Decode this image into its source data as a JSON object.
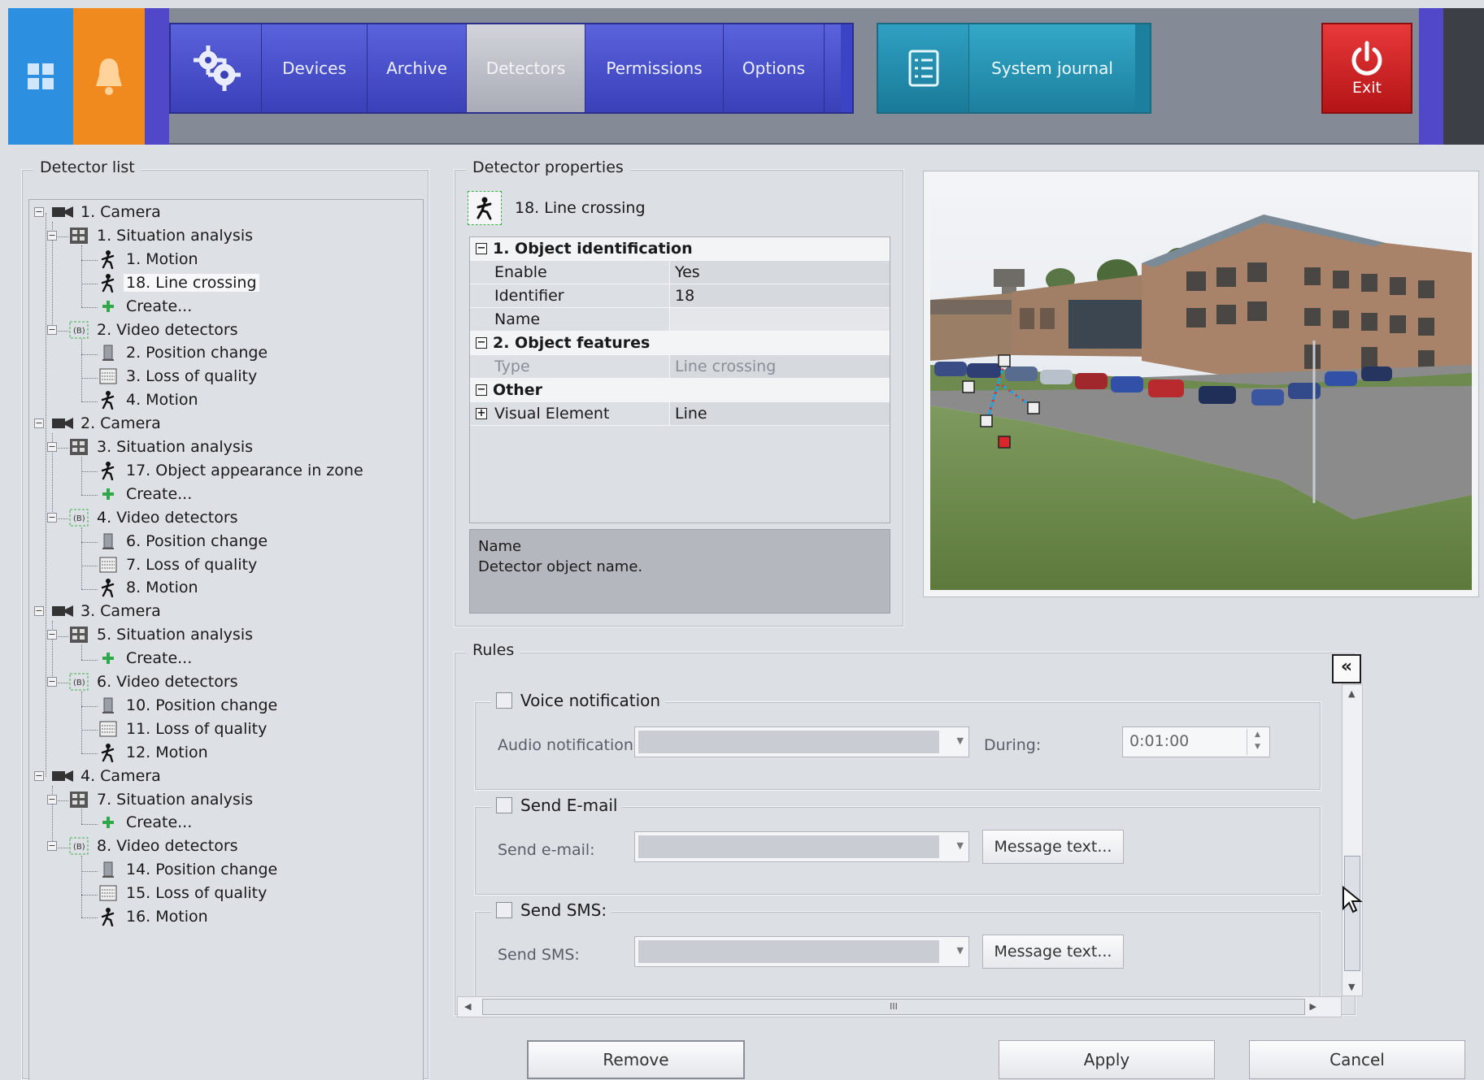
{
  "topbar": {
    "tiles": {
      "windows_icon": "windows-icon",
      "bell_icon": "bell-icon"
    },
    "nav": {
      "settings_icon": "gears-icon",
      "devices": "Devices",
      "archive": "Archive",
      "detectors": "Detectors",
      "permissions": "Permissions",
      "options": "Options",
      "active": "Detectors"
    },
    "journal": {
      "icon": "checklist-icon",
      "label": "System journal"
    },
    "exit": {
      "icon": "power-icon",
      "label": "Exit"
    }
  },
  "detector_list": {
    "title": "Detector list",
    "tree": [
      {
        "level": 0,
        "type": "camera",
        "label": "1. Camera",
        "expanded": true
      },
      {
        "level": 1,
        "type": "situation",
        "label": "1. Situation analysis",
        "expanded": true
      },
      {
        "level": 2,
        "type": "motion",
        "label": "1. Motion"
      },
      {
        "level": 2,
        "type": "motion",
        "label": "18. Line crossing",
        "selected": true
      },
      {
        "level": 2,
        "type": "create",
        "label": "Create..."
      },
      {
        "level": 1,
        "type": "video",
        "label": "2. Video detectors",
        "expanded": true
      },
      {
        "level": 2,
        "type": "position",
        "label": "2. Position change"
      },
      {
        "level": 2,
        "type": "quality",
        "label": "3. Loss of quality"
      },
      {
        "level": 2,
        "type": "motion",
        "label": "4. Motion"
      },
      {
        "level": 0,
        "type": "camera",
        "label": "2. Camera",
        "expanded": true
      },
      {
        "level": 1,
        "type": "situation",
        "label": "3. Situation analysis",
        "expanded": true
      },
      {
        "level": 2,
        "type": "motion",
        "label": "17. Object appearance in zone"
      },
      {
        "level": 2,
        "type": "create",
        "label": "Create..."
      },
      {
        "level": 1,
        "type": "video",
        "label": "4. Video detectors",
        "expanded": true
      },
      {
        "level": 2,
        "type": "position",
        "label": "6. Position change"
      },
      {
        "level": 2,
        "type": "quality",
        "label": "7. Loss of quality"
      },
      {
        "level": 2,
        "type": "motion",
        "label": "8. Motion"
      },
      {
        "level": 0,
        "type": "camera",
        "label": "3. Camera",
        "expanded": true
      },
      {
        "level": 1,
        "type": "situation",
        "label": "5. Situation analysis",
        "expanded": true
      },
      {
        "level": 2,
        "type": "create",
        "label": "Create..."
      },
      {
        "level": 1,
        "type": "video",
        "label": "6. Video detectors",
        "expanded": true
      },
      {
        "level": 2,
        "type": "position",
        "label": "10. Position change"
      },
      {
        "level": 2,
        "type": "quality",
        "label": "11. Loss of quality"
      },
      {
        "level": 2,
        "type": "motion",
        "label": "12. Motion"
      },
      {
        "level": 0,
        "type": "camera",
        "label": "4. Camera",
        "expanded": true
      },
      {
        "level": 1,
        "type": "situation",
        "label": "7. Situation analysis",
        "expanded": true
      },
      {
        "level": 2,
        "type": "create",
        "label": "Create..."
      },
      {
        "level": 1,
        "type": "video",
        "label": "8. Video detectors",
        "expanded": true
      },
      {
        "level": 2,
        "type": "position",
        "label": "14. Position change"
      },
      {
        "level": 2,
        "type": "quality",
        "label": "15. Loss of quality"
      },
      {
        "level": 2,
        "type": "motion",
        "label": "16. Motion"
      }
    ]
  },
  "detector_properties": {
    "title": "Detector properties",
    "header": {
      "icon": "line-crossing-icon",
      "label": "18. Line crossing"
    },
    "grid": {
      "cat1": "1. Object identification",
      "enable_name": "Enable",
      "enable_value": "Yes",
      "identifier_name": "Identifier",
      "identifier_value": "18",
      "name_name": "Name",
      "name_value": "",
      "cat2": "2. Object features",
      "type_name": "Type",
      "type_value": "Line crossing",
      "cat3": "Other",
      "visual_name": "Visual Element",
      "visual_value": "Line"
    },
    "help": {
      "title": "Name",
      "text": "Detector object name."
    }
  },
  "rules": {
    "title": "Rules",
    "collapse_label": "«",
    "voice": {
      "title": "Voice notification",
      "audio_label": "Audio notification:",
      "during_label": "During:",
      "during_value": "0:01:00"
    },
    "email": {
      "title": "Send E-mail",
      "label": "Send e-mail:",
      "button": "Message text..."
    },
    "sms": {
      "title": "Send SMS:",
      "label": "Send SMS:",
      "button": "Message text..."
    },
    "hscroll_grip": "III"
  },
  "buttons": {
    "remove": "Remove",
    "apply": "Apply",
    "cancel": "Cancel"
  },
  "colors": {
    "windows_tile": "#2d8fe0",
    "bell_tile": "#f08a1e",
    "nav_blue": "#3a44c4",
    "journal_teal": "#1c7f9e",
    "exit_red": "#d42a2c"
  }
}
